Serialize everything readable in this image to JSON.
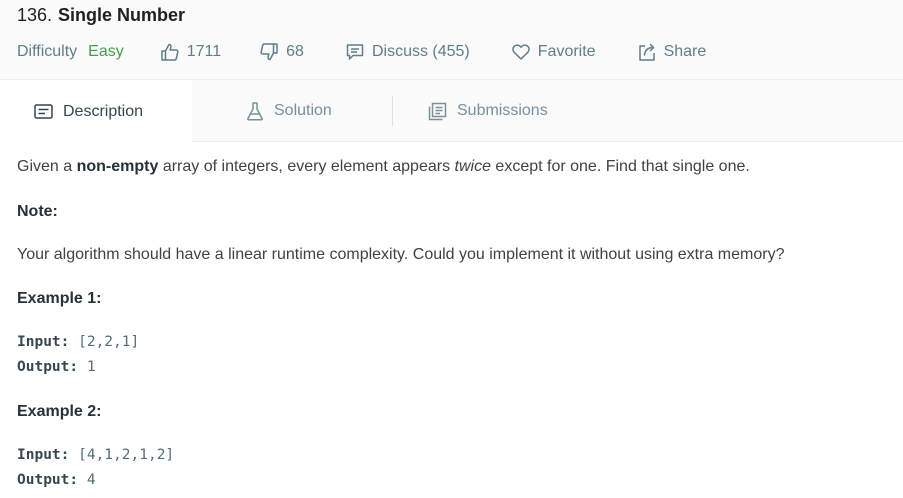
{
  "problem": {
    "number": "136.",
    "title": "Single Number"
  },
  "meta": {
    "difficulty_label": "Difficulty",
    "difficulty_value": "Easy",
    "likes": "1711",
    "dislikes": "68",
    "discuss": "Discuss (455)",
    "favorite": "Favorite",
    "share": "Share"
  },
  "tabs": [
    {
      "label": "Description",
      "icon": "description-icon",
      "active": true
    },
    {
      "label": "Solution",
      "icon": "flask-icon",
      "active": false
    },
    {
      "label": "Submissions",
      "icon": "submissions-icon",
      "active": false
    }
  ],
  "description": {
    "intro_pre": "Given a ",
    "intro_bold": "non-empty",
    "intro_mid": " array of integers, every element appears ",
    "intro_italic": "twice",
    "intro_post": " except for one. Find that single one.",
    "note_title": "Note:",
    "note_text": "Your algorithm should have a linear runtime complexity. Could you implement it without using extra memory?",
    "examples": [
      {
        "title": "Example 1:",
        "input_label": "Input:",
        "input_value": " [2,2,1]",
        "output_label": "Output:",
        "output_value": " 1"
      },
      {
        "title": "Example 2:",
        "input_label": "Input:",
        "input_value": " [4,1,2,1,2]",
        "output_label": "Output:",
        "output_value": " 4"
      }
    ]
  },
  "colors": {
    "easy": "#43a047",
    "meta": "#607d8b",
    "header_bg": "#fafafa"
  }
}
